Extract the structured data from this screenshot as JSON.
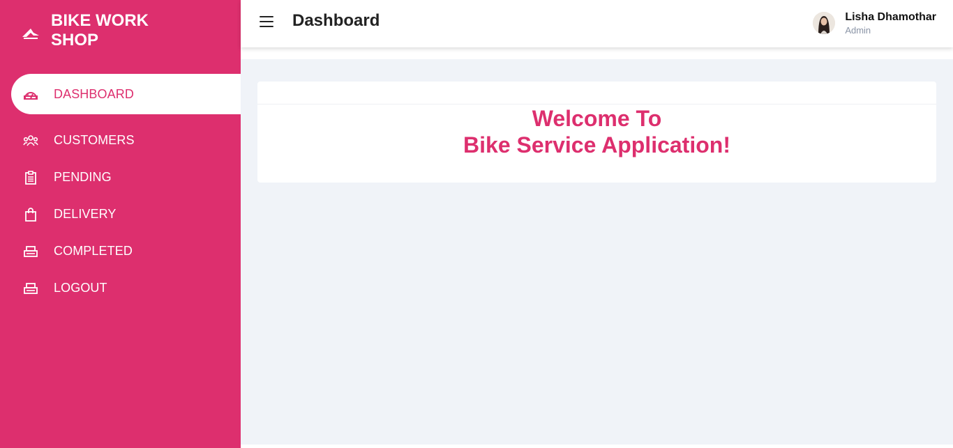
{
  "brand": {
    "name": "BIKE WORK SHOP",
    "icon": "bike-logo-icon"
  },
  "sidebar": {
    "items": [
      {
        "label": "DASHBOARD",
        "icon": "dashboard-icon",
        "active": true
      },
      {
        "label": "CUSTOMERS",
        "icon": "customers-icon"
      },
      {
        "label": "PENDING",
        "icon": "clipboard-icon"
      },
      {
        "label": "DELIVERY",
        "icon": "shopping-bag-icon"
      },
      {
        "label": "COMPLETED",
        "icon": "printer-icon"
      },
      {
        "label": "LOGOUT",
        "icon": "printer-icon"
      }
    ]
  },
  "header": {
    "title": "Dashboard",
    "menu_icon": "hamburger-menu-icon",
    "user": {
      "name": "Lisha Dhamothar",
      "role": "Admin"
    }
  },
  "main": {
    "welcome_line1": "Welcome To",
    "welcome_line2": "Bike Service Application!"
  },
  "colors": {
    "brand": "#dd2f6e",
    "background": "#f0f3f8"
  }
}
